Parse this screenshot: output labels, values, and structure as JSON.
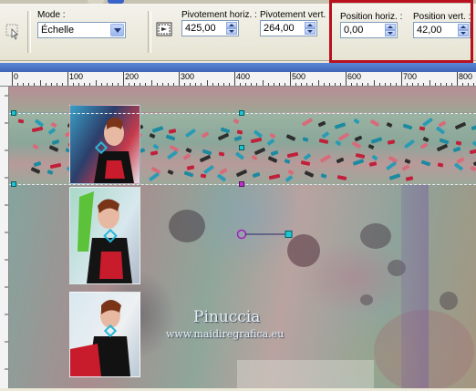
{
  "toolbar": {
    "mode_label": "Mode :",
    "mode_value": "Échelle",
    "pivot_h_label": "Pivotement horiz. :",
    "pivot_h_value": "425,00",
    "pivot_v_label": "Pivotement vert. :",
    "pivot_v_value": "264,00",
    "pos_h_label": "Position horiz. :",
    "pos_h_value": "0,00",
    "pos_v_label": "Position vert. :",
    "pos_v_value": "42,00"
  },
  "ruler": {
    "labels": [
      "0",
      "100",
      "200",
      "300",
      "400",
      "500",
      "600",
      "700",
      "800"
    ]
  },
  "canvas": {
    "watermark_name": "Pinuccia",
    "watermark_url": "www.maidiregrafica.eu"
  },
  "colors": {
    "highlight": "#b9101e",
    "handle": "#19c6d2",
    "pivot": "#a020c0"
  }
}
